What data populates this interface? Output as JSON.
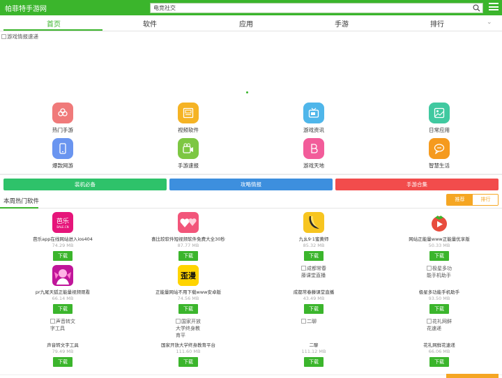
{
  "header": {
    "site_title": "帕菲特手游网",
    "search_value": "电竞社交",
    "brand_color": "#3bb52c"
  },
  "nav": {
    "tabs": [
      {
        "label": "首页",
        "active": true
      },
      {
        "label": "软件",
        "active": false
      },
      {
        "label": "应用",
        "active": false
      },
      {
        "label": "手游",
        "active": false
      },
      {
        "label": "排行",
        "active": false
      }
    ]
  },
  "banner": {
    "alt_text": "游戏情报速递"
  },
  "categories": [
    {
      "label": "热门手游",
      "icon": "clover-icon",
      "color": "#f07a7a"
    },
    {
      "label": "视频软件",
      "icon": "video-app-icon",
      "color": "#f5b324"
    },
    {
      "label": "游戏资讯",
      "icon": "tv-icon",
      "color": "#4fb6ea"
    },
    {
      "label": "日常应用",
      "icon": "image-icon",
      "color": "#40c9a0"
    },
    {
      "label": "爆款网游",
      "icon": "phone-icon",
      "color": "#6a95f0"
    },
    {
      "label": "手游速报",
      "icon": "camera-icon",
      "color": "#7dc743"
    },
    {
      "label": "游戏天地",
      "icon": "letter-b-icon",
      "color": "#f25c9a"
    },
    {
      "label": "智慧生活",
      "icon": "chat-icon",
      "color": "#f59a1e"
    }
  ],
  "pills": [
    {
      "label": "装机必备",
      "color": "#2ec26a"
    },
    {
      "label": "攻略情报",
      "color": "#3d8fde"
    },
    {
      "label": "手游合集",
      "color": "#f24c4c"
    }
  ],
  "hot_section": {
    "title": "本周热门软件",
    "toggle": [
      "推荐",
      "排行"
    ],
    "download_label": "下载",
    "apps": [
      {
        "name": "芭乐app在线网站进入ios404",
        "size": "74.29 MB",
        "alt": "",
        "icon": "bala-app-icon",
        "color": "#e6157a"
      },
      {
        "name": "喜比较软件短视频软件免费大全30秒",
        "size": "87.77 MB",
        "alt": "",
        "icon": "hearts-app-icon",
        "color": "#f2557a"
      },
      {
        "name": "九幺9·1蜜黄师",
        "size": "85.32 MB",
        "alt": "",
        "icon": "banana-app-icon",
        "color": "#f7c520"
      },
      {
        "name": "网站正能量www正能量优享版",
        "size": "50.33 MB",
        "alt": "",
        "icon": "tomato-app-icon",
        "color": "#e84c3d"
      },
      {
        "name": "pr九尾天狐正能量视频观看",
        "size": "66.14 MB",
        "alt": "",
        "icon": "fox-app-icon",
        "color": "#c0169a"
      },
      {
        "name": "正能量网站不用下载www安卓版",
        "size": "74.56 MB",
        "alt": "",
        "icon": "comic-app-icon",
        "color": "#ffd400"
      },
      {
        "name": "成都常春藤课堂直播",
        "size": "43.49 MB",
        "alt": "成都常春藤课堂直播",
        "icon": "",
        "color": ""
      },
      {
        "name": "极星多功能手机助手",
        "size": "93.50 MB",
        "alt": "极星多功能手机助手",
        "icon": "",
        "color": ""
      },
      {
        "name": "声音转文字工具",
        "size": "79.49 MB",
        "alt": "声音转文字工具",
        "icon": "",
        "color": ""
      },
      {
        "name": "国家开放大学终身教育平台",
        "size": "111.60 MB",
        "alt": "国家开放大学终身教育平",
        "icon": "",
        "color": ""
      },
      {
        "name": "二聊",
        "size": "111.12 MB",
        "alt": "二聊",
        "icon": "",
        "color": ""
      },
      {
        "name": "花礼网鲜花速递",
        "size": "66.06 MB",
        "alt": "花礼网鲜花速递",
        "icon": "",
        "color": ""
      }
    ]
  }
}
